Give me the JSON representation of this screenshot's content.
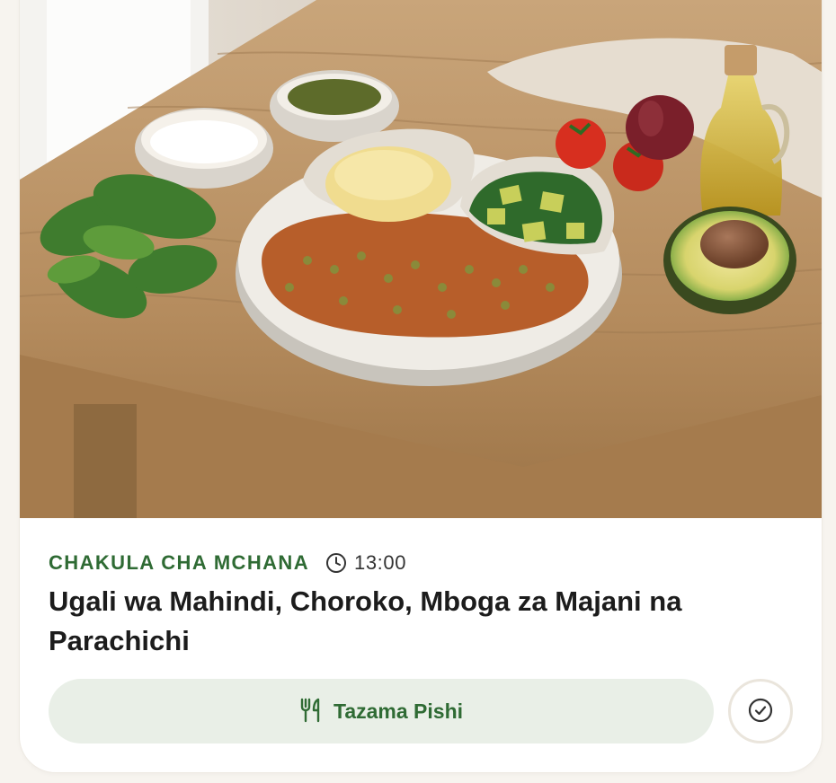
{
  "meal": {
    "type_label": "CHAKULA CHA MCHANA",
    "time": "13:00",
    "title": "Ugali wa Mahindi, Choroko, Mboga za Majani na Parachichi"
  },
  "actions": {
    "recipe_label": "Tazama Pishi"
  },
  "icons": {
    "clock": "clock-icon",
    "utensils": "fork-knife-icon",
    "check": "check-circle-icon"
  },
  "colors": {
    "accent": "#2f6b34",
    "button_bg": "#e9efe7",
    "card_bg": "#ffffff",
    "page_bg": "#f7f4ef"
  }
}
